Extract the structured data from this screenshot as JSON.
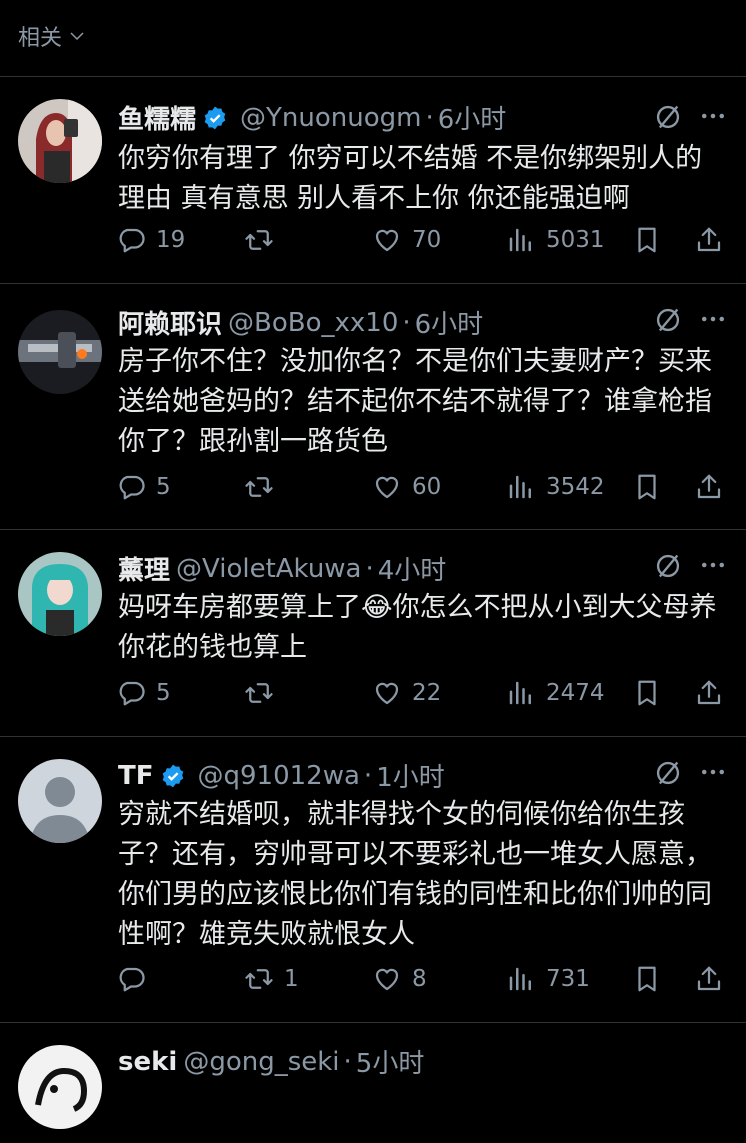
{
  "header": {
    "sort_label": "相关"
  },
  "tweets": [
    {
      "name": "鱼糯糯",
      "verified": true,
      "handle": "@Ynuonuogm",
      "time": "6小时",
      "text": "你穷你有理了 你穷可以不结婚 不是你绑架别人的理由 真有意思 别人看不上你 你还能强迫啊",
      "replies": "19",
      "retweets": "",
      "likes": "70",
      "views": "5031"
    },
    {
      "name": "阿赖耶识",
      "verified": false,
      "handle": "@BoBo_xx10",
      "time": "6小时",
      "text": "房子你不住？没加你名？不是你们夫妻财产？买来送给她爸妈的？结不起你不结不就得了？谁拿枪指你了？跟孙割一路货色",
      "replies": "5",
      "retweets": "",
      "likes": "60",
      "views": "3542"
    },
    {
      "name": "薰理",
      "verified": false,
      "handle": "@VioletAkuwa",
      "time": "4小时",
      "text": "妈呀车房都要算上了😂你怎么不把从小到大父母养你花的钱也算上",
      "replies": "5",
      "retweets": "",
      "likes": "22",
      "views": "2474"
    },
    {
      "name": "TF",
      "verified": true,
      "handle": "@q91012wa",
      "time": "1小时",
      "text": "穷就不结婚呗，就非得找个女的伺候你给你生孩子？还有，穷帅哥可以不要彩礼也一堆女人愿意，你们男的应该恨比你们有钱的同性和比你们帅的同性啊？雄竞失败就恨女人",
      "replies": "",
      "retweets": "1",
      "likes": "8",
      "views": "731"
    },
    {
      "name": "seki",
      "verified": false,
      "handle": "@gong_seki",
      "time": "5小时"
    }
  ],
  "colors": {
    "background": "#000000",
    "text": "#e7e9ea",
    "muted": "#8b98a5",
    "verified": "#1d9bf0",
    "divider": "#2f3336"
  },
  "icons": [
    "chevron-down-icon",
    "verified-badge-icon",
    "grok-icon",
    "more-icon",
    "reply-icon",
    "retweet-icon",
    "like-icon",
    "views-icon",
    "bookmark-icon",
    "share-icon"
  ]
}
